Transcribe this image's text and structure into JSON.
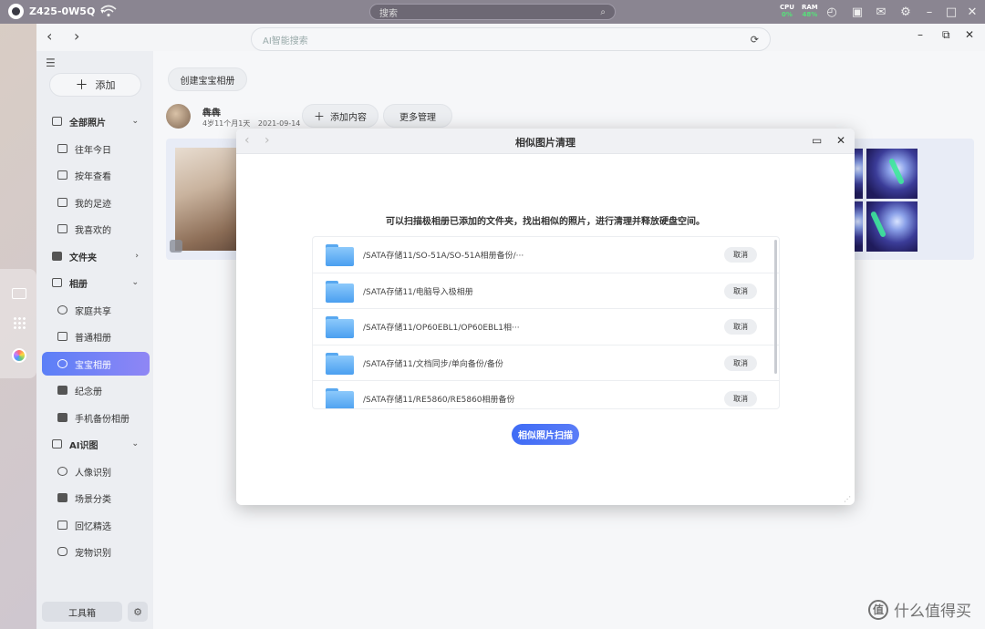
{
  "topbar": {
    "device_name": "Z425-0W5Q",
    "search_placeholder": "搜索",
    "cpu_label": "CPU",
    "cpu_value": "0%",
    "ram_label": "RAM",
    "ram_value": "48%"
  },
  "app": {
    "ai_search_placeholder": "AI智能搜索"
  },
  "sidebar": {
    "add_label": "添加",
    "items": [
      {
        "label": "全部照片"
      },
      {
        "label": "往年今日"
      },
      {
        "label": "按年查看"
      },
      {
        "label": "我的足迹"
      },
      {
        "label": "我喜欢的"
      },
      {
        "label": "文件夹"
      },
      {
        "label": "相册"
      },
      {
        "label": "家庭共享"
      },
      {
        "label": "普通相册"
      },
      {
        "label": "宝宝相册"
      },
      {
        "label": "纪念册"
      },
      {
        "label": "手机备份相册"
      },
      {
        "label": "AI识图"
      },
      {
        "label": "人像识别"
      },
      {
        "label": "场景分类"
      },
      {
        "label": "回忆精选"
      },
      {
        "label": "宠物识别"
      }
    ],
    "toolbox_label": "工具箱"
  },
  "content": {
    "create_album_label": "创建宝宝相册",
    "baby_name": "犇犇",
    "baby_age": "4岁11个月1天",
    "baby_birthday": "2021-09-14",
    "add_content_label": "添加内容",
    "more_manage_label": "更多管理"
  },
  "dialog": {
    "title": "相似图片清理",
    "description": "可以扫描极相册已添加的文件夹，找出相似的照片，进行清理并释放硬盘空间。",
    "folders": [
      {
        "path": "/SATA存储11/SO-51A/SO-51A相册备份/···",
        "action": "取消"
      },
      {
        "path": "/SATA存储11/电脑导入极相册",
        "action": "取消"
      },
      {
        "path": "/SATA存储11/OP60EBL1/OP60EBL1相···",
        "action": "取消"
      },
      {
        "path": "/SATA存储11/文档同步/单向备份/备份",
        "action": "取消"
      },
      {
        "path": "/SATA存储11/RE5860/RE5860相册备份",
        "action": "取消"
      }
    ],
    "scan_label": "相似照片扫描"
  },
  "watermark": {
    "badge": "值",
    "text": "什么值得买"
  }
}
